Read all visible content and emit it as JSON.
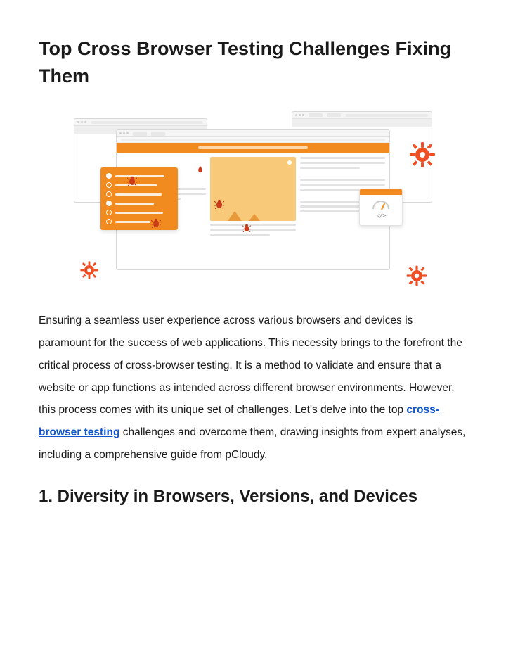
{
  "title": "Top Cross Browser Testing Challenges Fixing Them",
  "intro": {
    "part1": "Ensuring a seamless user experience across various browsers and devices is paramount for the success of web applications. This necessity brings to the forefront the critical process of cross-browser testing. It is a method to validate and ensure that a website or app functions as intended across different browser environments. However, this process comes with its unique set of challenges. Let's delve into the top ",
    "link_text": "cross-browser testing",
    "part2": " challenges and overcome them, drawing insights from expert analyses, including a comprehensive guide from pCloudy."
  },
  "section1_title": "1. Diversity in Browsers, Versions, and Devices"
}
